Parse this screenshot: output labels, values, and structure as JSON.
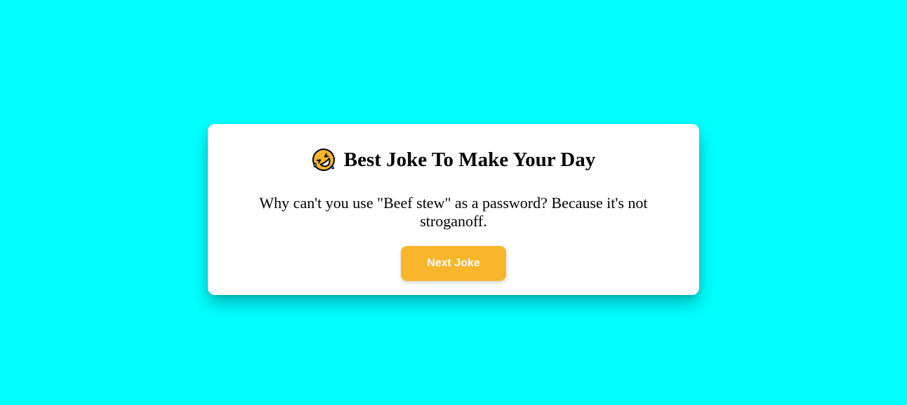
{
  "page": {
    "background_color": "#00ffff"
  },
  "card": {
    "title": "Best Joke To Make Your Day",
    "title_icon": "rolling-on-floor-laughing-emoji-icon",
    "joke_text": "Why can't you use \"Beef stew\" as a password? Because it's not stroganoff.",
    "next_button_label": "Next Joke",
    "button_color": "#f9b52c"
  }
}
